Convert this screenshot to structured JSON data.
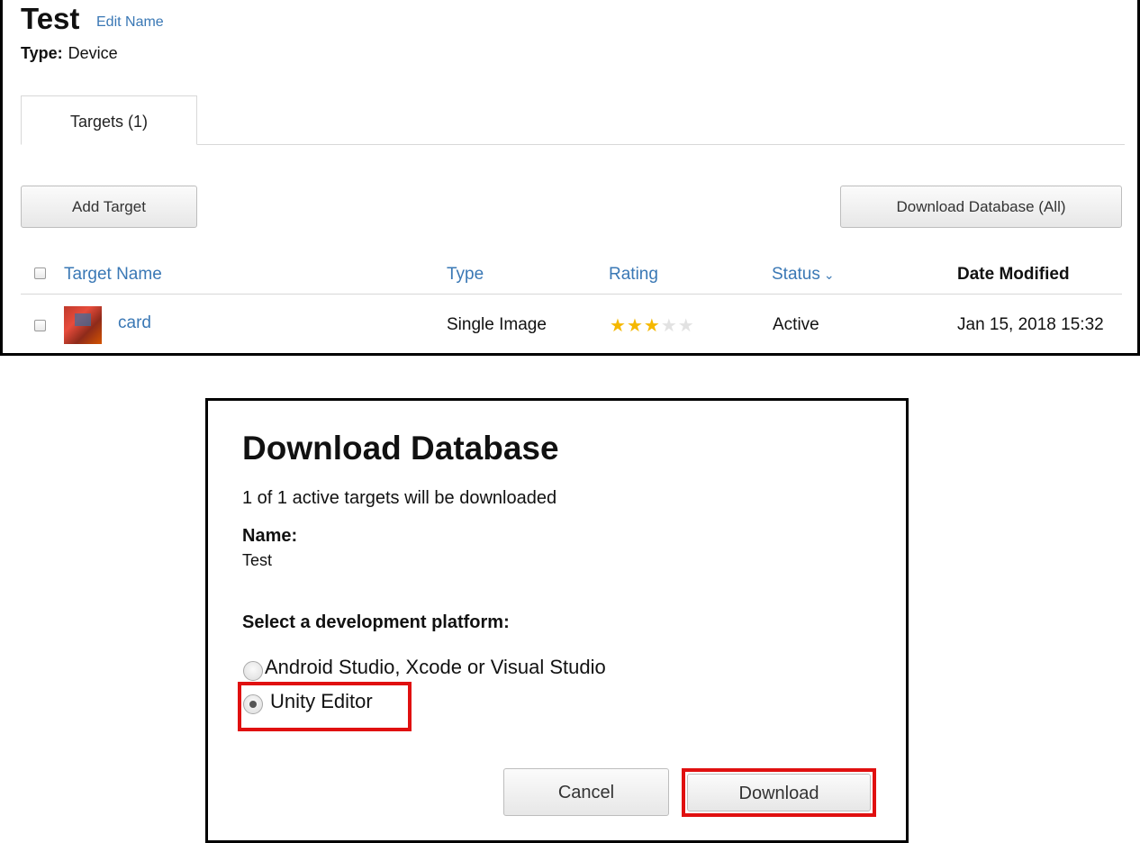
{
  "database": {
    "title": "Test",
    "edit_link": "Edit Name",
    "type_label": "Type:",
    "type_value": "Device"
  },
  "tabs": [
    {
      "label": "Targets (1)",
      "active": true
    }
  ],
  "toolbar": {
    "add_target": "Add Target",
    "download_all": "Download Database (All)"
  },
  "table": {
    "columns": {
      "name": "Target Name",
      "type": "Type",
      "rating": "Rating",
      "status": "Status",
      "date": "Date Modified"
    },
    "rows": [
      {
        "name": "card",
        "type": "Single Image",
        "rating": 3,
        "rating_max": 5,
        "status": "Active",
        "date": "Jan 15, 2018 15:32"
      }
    ]
  },
  "dialog": {
    "title": "Download Database",
    "count_text": "1 of 1 active targets will be downloaded",
    "name_label": "Name:",
    "name_value": "Test",
    "platform_label": "Select a development platform:",
    "options": [
      {
        "label": "Android Studio, Xcode or Visual Studio",
        "selected": false
      },
      {
        "label": "Unity Editor",
        "selected": true
      }
    ],
    "cancel": "Cancel",
    "download": "Download"
  },
  "colors": {
    "link": "#3a78b5",
    "star_on": "#f5b800",
    "star_off": "#e2e2e2",
    "highlight": "#e01010"
  },
  "icons": {
    "status_sort": "chevron-down-icon",
    "rating": "star-icon"
  }
}
